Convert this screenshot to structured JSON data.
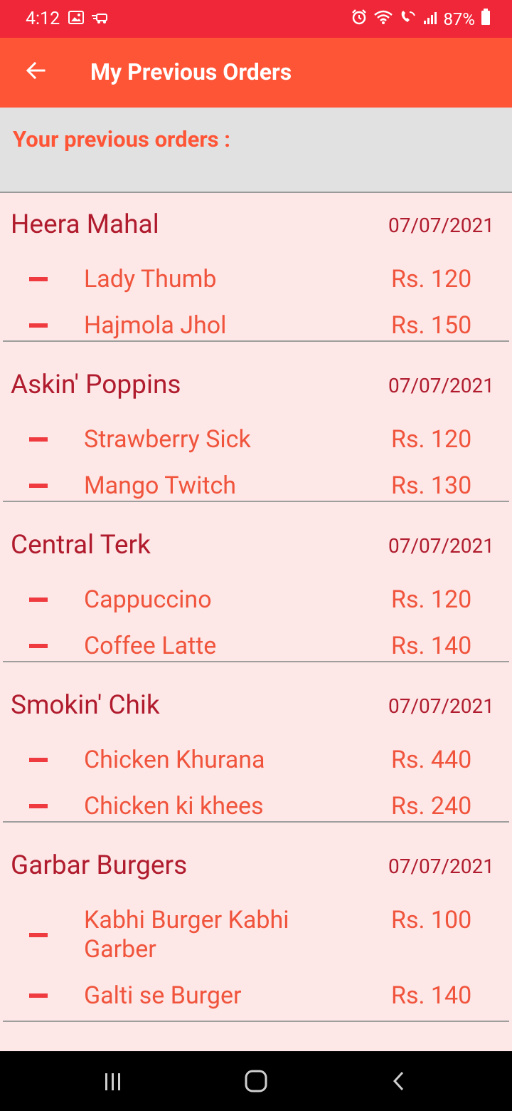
{
  "status_bar": {
    "time": "4:12",
    "battery": "87%"
  },
  "app_bar": {
    "title": "My Previous Orders"
  },
  "section": {
    "title": "Your previous orders :"
  },
  "orders": [
    {
      "restaurant": "Heera Mahal",
      "date": "07/07/2021",
      "items": [
        {
          "name": "Lady Thumb",
          "price": "Rs. 120"
        },
        {
          "name": "Hajmola Jhol",
          "price": "Rs. 150"
        }
      ]
    },
    {
      "restaurant": "Askin' Poppins",
      "date": "07/07/2021",
      "items": [
        {
          "name": "Strawberry Sick",
          "price": "Rs. 120"
        },
        {
          "name": "Mango Twitch",
          "price": "Rs. 130"
        }
      ]
    },
    {
      "restaurant": "Central Terk",
      "date": "07/07/2021",
      "items": [
        {
          "name": "Cappuccino",
          "price": "Rs. 120"
        },
        {
          "name": "Coffee Latte",
          "price": "Rs. 140"
        }
      ]
    },
    {
      "restaurant": "Smokin' Chik",
      "date": "07/07/2021",
      "items": [
        {
          "name": "Chicken Khurana",
          "price": "Rs. 440"
        },
        {
          "name": "Chicken ki khees",
          "price": "Rs. 240"
        }
      ]
    },
    {
      "restaurant": "Garbar Burgers",
      "date": "07/07/2021",
      "items": [
        {
          "name": "Kabhi Burger Kabhi Garber",
          "price": "Rs. 100"
        },
        {
          "name": "Galti se Burger",
          "price": "Rs. 140"
        }
      ]
    }
  ],
  "colors": {
    "status_bar": "#ef2738",
    "app_bar": "#ff5537",
    "list_bg": "#fde7e7",
    "restaurant_text": "#b01c2e",
    "item_text": "#f0543c"
  },
  "icons": {
    "back": "arrow-left-icon",
    "recents": "recents-icon",
    "home": "home-icon",
    "nav_back": "chevron-left-icon"
  }
}
